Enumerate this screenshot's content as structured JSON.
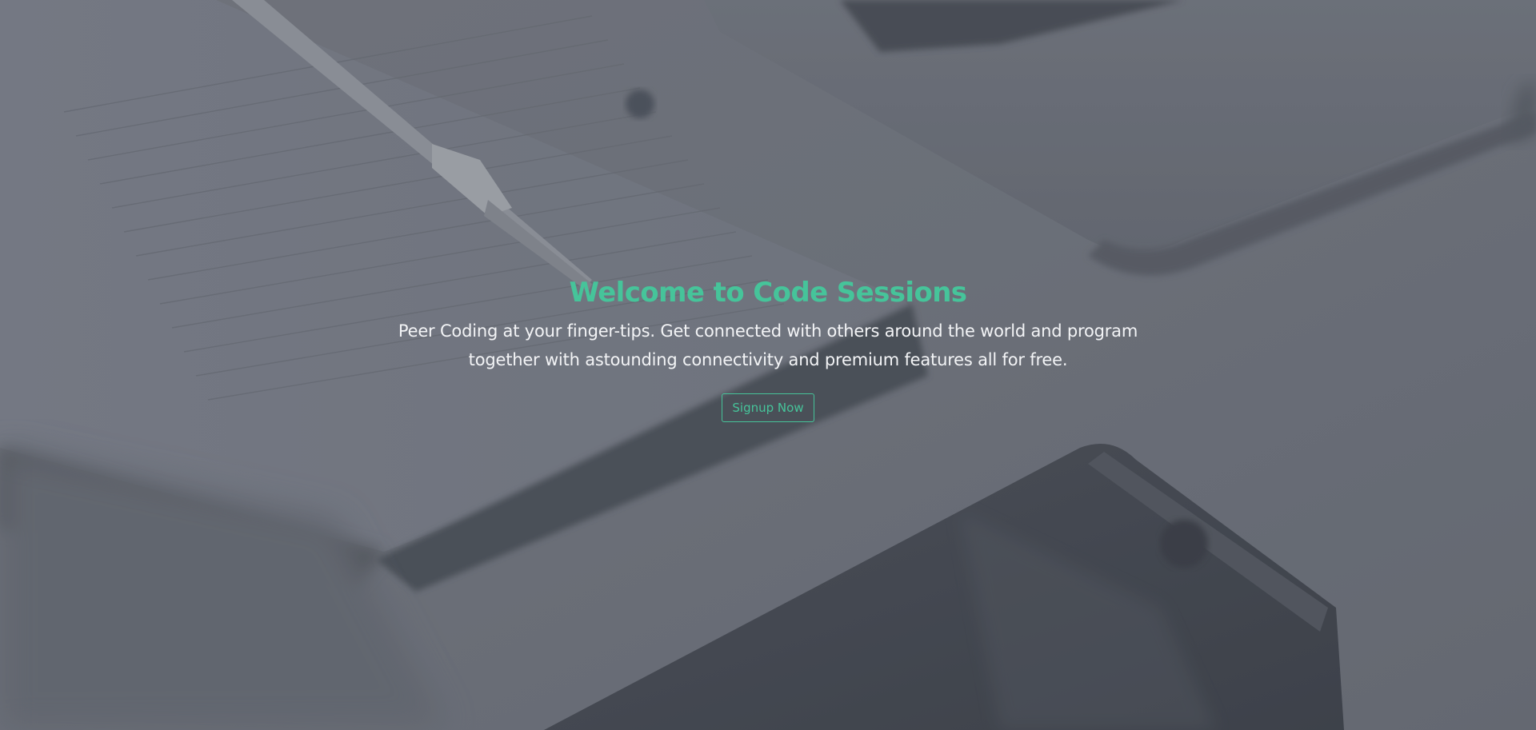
{
  "hero": {
    "title": "Welcome to Code Sessions",
    "subtitle": "Peer Coding at your finger-tips. Get connected with others around the world and program together with astounding connectivity and premium features all for free.",
    "signup_label": "Signup Now"
  },
  "colors": {
    "accent": "#46c49a",
    "text": "#f3f4f6",
    "background": "#6f737d"
  },
  "background_image": {
    "icon_names": [
      "notebook-photo",
      "pen-photo",
      "laptop-photo",
      "smartphone-photo"
    ]
  }
}
